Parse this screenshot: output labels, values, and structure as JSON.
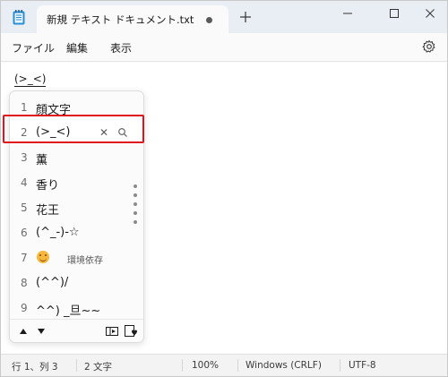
{
  "tab": {
    "title": "新規 テキスト ドキュメント.txt"
  },
  "menu": {
    "items": [
      "ファイル",
      "編集",
      "表示"
    ]
  },
  "editor": {
    "composition_text": "(>_<)"
  },
  "ime": {
    "candidates": [
      {
        "num": "1",
        "text": "顔文字"
      },
      {
        "num": "2",
        "text": "(>_<)"
      },
      {
        "num": "3",
        "text": "薫"
      },
      {
        "num": "4",
        "text": "香り"
      },
      {
        "num": "5",
        "text": "花王"
      },
      {
        "num": "6",
        "text": "(^_-)-☆"
      },
      {
        "num": "7",
        "text": "",
        "tag": "環境依存",
        "emoji": "smiling-face-emoji"
      },
      {
        "num": "8",
        "text": "(^^)/"
      },
      {
        "num": "9",
        "text": " ^^) _旦~~"
      }
    ],
    "selected_index": 1
  },
  "statusbar": {
    "position": "行 1、列 3",
    "char_count": "2 文字",
    "zoom": "100%",
    "line_ending": "Windows (CRLF)",
    "encoding": "UTF-8"
  },
  "colors": {
    "selection_highlight": "#e0141e",
    "titlebar_bg": "#e9eef4",
    "accent_icon": "#2a8fd6"
  },
  "icons": [
    "notepad-app-icon",
    "unsaved-dot-icon",
    "plus-icon",
    "minimize-icon",
    "maximize-icon",
    "close-icon",
    "gear-icon",
    "close-candidate-icon",
    "search-icon",
    "arrow-up-icon",
    "arrow-down-icon",
    "expand-table-icon",
    "favorite-icon"
  ]
}
